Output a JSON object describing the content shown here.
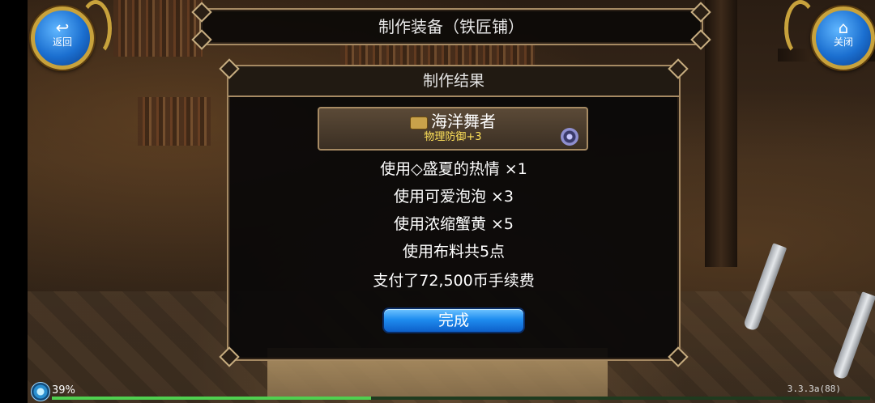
{
  "header": {
    "title": "制作装备（铁匠铺）",
    "back_label": "返回",
    "close_label": "关闭"
  },
  "result_panel": {
    "title": "制作结果",
    "item": {
      "name": "海洋舞者",
      "stat": "物理防御+3"
    },
    "materials": [
      "使用◇盛夏的热情  ×1",
      "使用可爱泡泡  ×3",
      "使用浓缩蟹黄  ×5",
      "使用布料共5点"
    ],
    "fee": "支付了72,500币手续费",
    "done_label": "完成"
  },
  "status": {
    "battery": "39%",
    "progress_fraction": 0.39,
    "version": "3.3.3a(88)"
  },
  "colors": {
    "accent_blue": "#1f8df0",
    "gold": "#c8a23c",
    "stat_yellow": "#ffe25a"
  }
}
